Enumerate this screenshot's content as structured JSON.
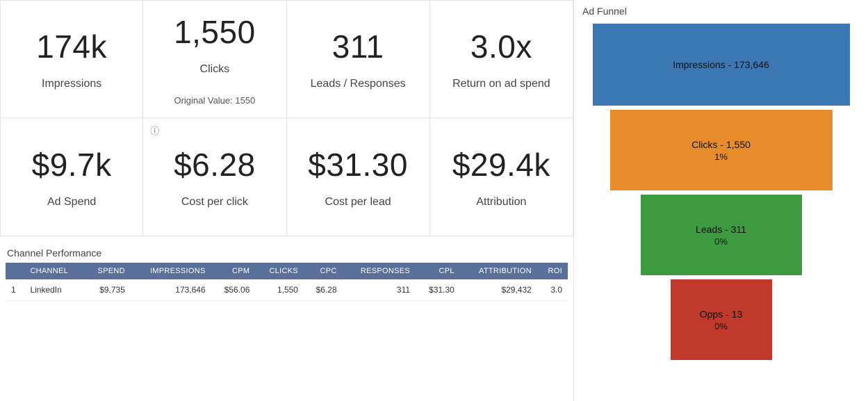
{
  "metrics": [
    {
      "value": "174k",
      "label": "Impressions",
      "sublabel": "",
      "info": false
    },
    {
      "value": "1,550",
      "label": "Clicks",
      "sublabel": "Original Value: 1550",
      "info": false
    },
    {
      "value": "311",
      "label": "Leads / Responses",
      "sublabel": "",
      "info": false
    },
    {
      "value": "3.0x",
      "label": "Return on ad spend",
      "sublabel": "",
      "info": false
    },
    {
      "value": "$9.7k",
      "label": "Ad Spend",
      "sublabel": "",
      "info": false
    },
    {
      "value": "$6.28",
      "label": "Cost per click",
      "sublabel": "",
      "info": true
    },
    {
      "value": "$31.30",
      "label": "Cost per lead",
      "sublabel": "",
      "info": false
    },
    {
      "value": "$29.4k",
      "label": "Attribution",
      "sublabel": "",
      "info": false
    }
  ],
  "channel_table": {
    "title": "Channel Performance",
    "headers": [
      "",
      "CHANNEL",
      "SPEND",
      "IMPRESSIONS",
      "CPM",
      "CLICKS",
      "CPC",
      "RESPONSES",
      "CPL",
      "ATTRIBUTION",
      "ROI"
    ],
    "rows": [
      {
        "idx": "1",
        "channel": "LinkedIn",
        "spend": "$9,735",
        "impressions": "173,646",
        "cpm": "$56.06",
        "clicks": "1,550",
        "cpc": "$6.28",
        "responses": "311",
        "cpl": "$31.30",
        "attribution": "$29,432",
        "roi": "3.0"
      }
    ]
  },
  "funnel": {
    "title": "Ad Funnel",
    "steps": [
      {
        "label": "Impressions - 173,646",
        "meta": ""
      },
      {
        "label": "Clicks - 1,550",
        "meta": "1%"
      },
      {
        "label": "Leads - 311",
        "meta": "0%"
      },
      {
        "label": "Opps - 13",
        "meta": "0%"
      }
    ]
  },
  "chart_data": {
    "type": "bar",
    "title": "Ad Funnel",
    "categories": [
      "Impressions",
      "Clicks",
      "Leads",
      "Opps"
    ],
    "values": [
      173646,
      1550,
      311,
      13
    ],
    "conversion_rate_pct": [
      null,
      1,
      0,
      0
    ],
    "colors": [
      "#3b78b3",
      "#e68c2b",
      "#3e9a3e",
      "#c1392b"
    ],
    "xlabel": "",
    "ylabel": "",
    "ylim": [
      0,
      173646
    ]
  }
}
